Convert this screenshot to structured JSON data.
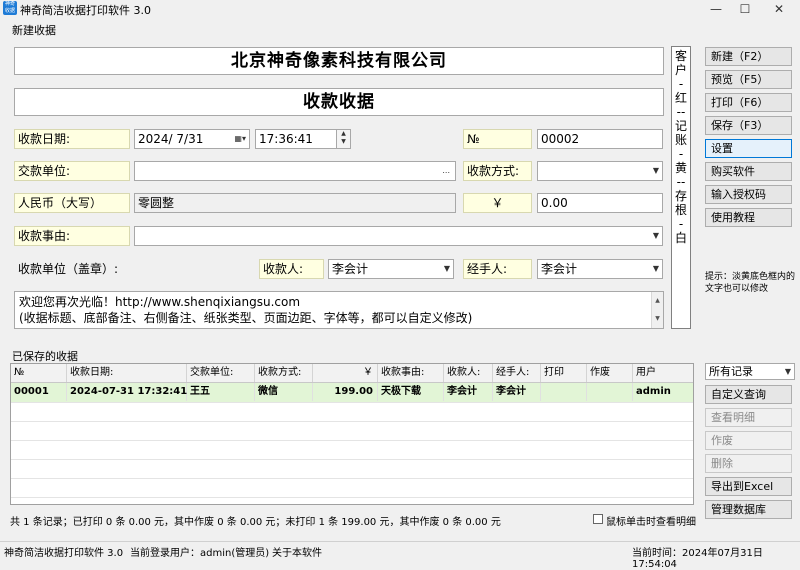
{
  "window": {
    "title": "神奇简洁收据打印软件 3.0",
    "icon_text": "神奇收据"
  },
  "form": {
    "group_title": "新建收据",
    "company_name": "北京神奇像素科技有限公司",
    "receipt_title": "收款收据",
    "labels": {
      "date": "收款日期:",
      "number": "№",
      "payer": "交款单位:",
      "method": "收款方式:",
      "rmb_upper": "人民币（大写）",
      "yen": "￥",
      "reason": "收款事由:",
      "seal": "收款单位（盖章）:",
      "receiver": "收款人:",
      "handler": "经手人:"
    },
    "values": {
      "date": "2024/  7/31",
      "time": "17:36:41",
      "number": "00002",
      "payer": "",
      "ellipsis": "...",
      "method": "",
      "rmb_upper": "零圆整",
      "amount": "0.00",
      "reason": "",
      "receiver": "李会计",
      "handler": "李会计"
    },
    "note_line1": "欢迎您再次光临！http://www.shenqixiangsu.com",
    "note_line2": "(收据标题、底部备注、右侧备注、纸张类型、页面边距、字体等，都可以自定义修改)",
    "side_note_chars": [
      "客",
      "户",
      "-",
      "红",
      "--",
      "记",
      "账",
      "-",
      "黄",
      "--",
      "存",
      "根",
      "-",
      "白"
    ]
  },
  "buttons": {
    "new": "新建（F2）",
    "preview": "预览（F5）",
    "print": "打印（F6）",
    "save": "保存（F3）",
    "settings": "设置",
    "buy": "购买软件",
    "license": "输入授权码",
    "tutorial": "使用教程",
    "hint": "提示：淡黄底色框内的文字也可以修改"
  },
  "saved": {
    "group_title": "已保存的收据",
    "columns": [
      "№",
      "收款日期:",
      "交款单位:",
      "收款方式:",
      "￥",
      "收款事由:",
      "收款人:",
      "经手人:",
      "打印",
      "作废",
      "用户"
    ],
    "rows": [
      [
        "00001",
        "2024-07-31 17:32:41",
        "王五",
        "微信",
        "199.00",
        "天极下载",
        "李会计",
        "李会计",
        "",
        "",
        "admin"
      ]
    ],
    "filter": "所有记录",
    "side_buttons": {
      "custom_query": "自定义查询",
      "view_detail": "查看明细",
      "void": "作废",
      "delete": "删除",
      "export": "导出到Excel",
      "manage_db": "管理数据库"
    },
    "summary": "共 1 条记录；已打印 0 条 0.00 元，其中作废 0 条 0.00 元；未打印 1 条 199.00 元，其中作废 0 条 0.00 元",
    "click_detail": "鼠标单击时查看明细"
  },
  "status": {
    "app": "神奇简洁收据打印软件 3.0",
    "user": "当前登录用户：admin(管理员)",
    "about": "关于本软件",
    "time": "当前时间：2024年07月31日  17:54:04"
  }
}
